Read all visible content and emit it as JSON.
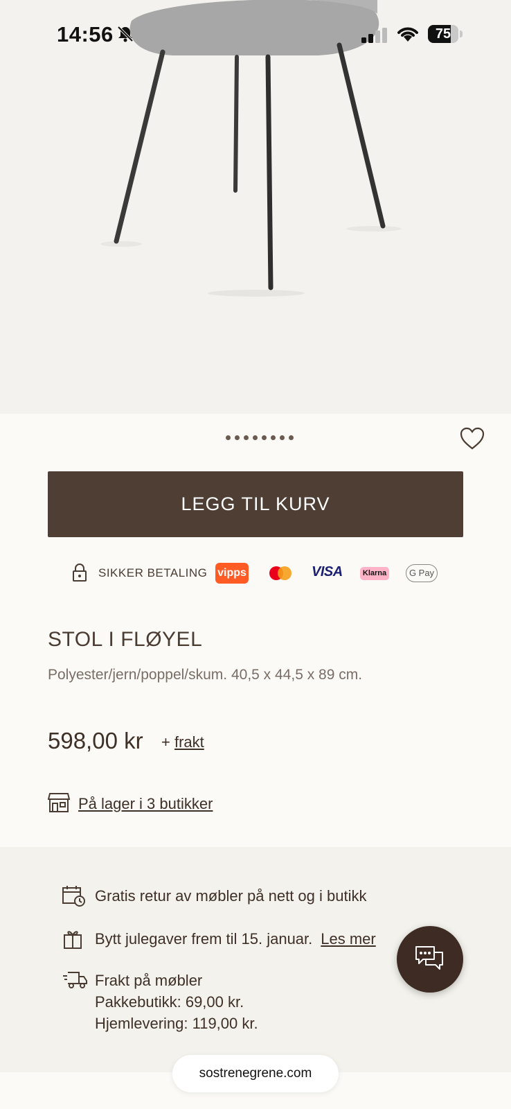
{
  "status_bar": {
    "time": "14:56",
    "battery": "75",
    "battery_level": 0.75
  },
  "gallery": {
    "dot_count": 8
  },
  "product": {
    "add_to_cart": "LEGG TIL KURV",
    "secure_payment": "SIKKER BETALING",
    "payment_methods": {
      "vipps": "vipps",
      "visa": "VISA",
      "klarna": "Klarna",
      "gpay": "G Pay"
    },
    "title": "STOL I FLØYEL",
    "description": "Polyester/jern/poppel/skum. 40,5 x 44,5 x 89 cm.",
    "price": "598,00 kr",
    "shipping_prefix": "+",
    "shipping_link": "frakt",
    "stock_link": "På lager i 3 butikker"
  },
  "info": {
    "returns": "Gratis retur av møbler på nett og i butikk",
    "exchange": "Bytt julegaver frem til 15. januar.",
    "exchange_link": "Les mer",
    "freight_title": "Frakt på møbler",
    "freight_pickup": "Pakkebutikk: 69,00 kr.",
    "freight_home": "Hjemlevering: 119,00 kr."
  },
  "browser": {
    "url": "sostrenegrene.com"
  },
  "colors": {
    "brand_brown": "#4e3e34",
    "chat_brown": "#3e2c24",
    "background": "#fbfaf6",
    "info_bg": "#f3f2ec"
  },
  "icons": [
    "bell-slash-icon",
    "cellular-signal-icon",
    "wifi-icon",
    "battery-icon",
    "heart-icon",
    "lock-icon",
    "store-icon",
    "calendar-icon",
    "gift-icon",
    "delivery-truck-icon",
    "chat-icon"
  ]
}
